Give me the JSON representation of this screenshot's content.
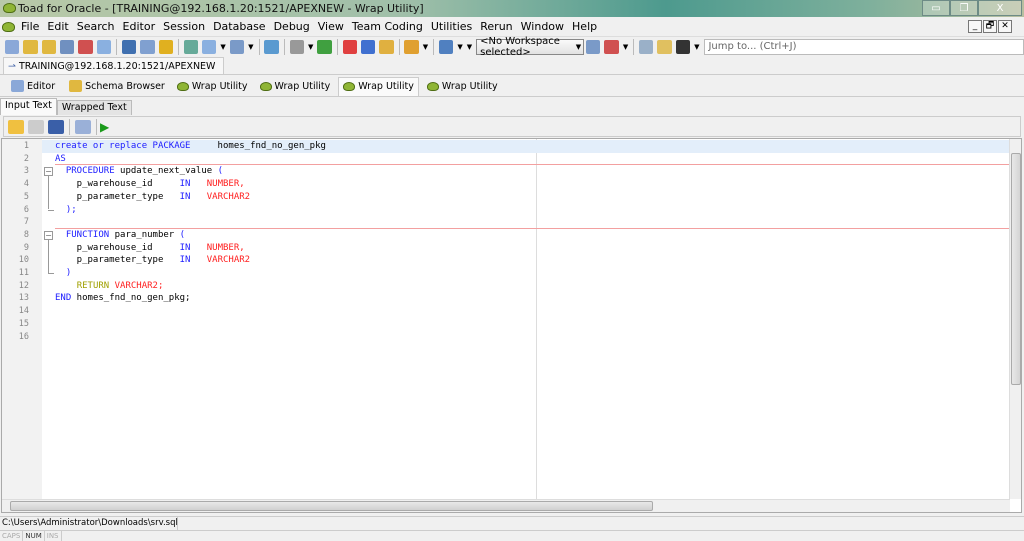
{
  "window": {
    "title": "Toad for Oracle - [TRAINING@192.168.1.20:1521/APEXNEW - Wrap Utility]",
    "minimize": "▭",
    "restore": "❐",
    "close": "X"
  },
  "menu": [
    "File",
    "Edit",
    "Search",
    "Editor",
    "Session",
    "Database",
    "Debug",
    "View",
    "Team Coding",
    "Utilities",
    "Rerun",
    "Window",
    "Help"
  ],
  "mdi_buttons": {
    "minimize": "_",
    "restore": "🗗",
    "close": "✕"
  },
  "toolbar": {
    "workspace": "<No Workspace selected>",
    "jump_placeholder": "Jump to... (Ctrl+J)"
  },
  "connection_tab": "TRAINING@192.168.1.20:1521/APEXNEW",
  "window_tabs": [
    {
      "label": "Editor",
      "icon": "editor-icon"
    },
    {
      "label": "Schema Browser",
      "icon": "schema-browser-icon"
    },
    {
      "label": "Wrap Utility",
      "icon": "frog-icon"
    },
    {
      "label": "Wrap Utility",
      "icon": "frog-icon"
    },
    {
      "label": "Wrap Utility",
      "icon": "frog-icon",
      "active": true
    },
    {
      "label": "Wrap Utility",
      "icon": "frog-icon"
    }
  ],
  "sub_tabs": [
    {
      "label": "Input Text",
      "active": true
    },
    {
      "label": "Wrapped Text"
    }
  ],
  "editor": {
    "lines": [
      [
        [
          "create or replace PACKAGE",
          "kw"
        ],
        [
          "     homes_fnd_no_gen_pkg",
          "id"
        ]
      ],
      [
        [
          "AS",
          "kw"
        ]
      ],
      [
        [
          "  ",
          "id"
        ],
        [
          "PROCEDURE",
          "kw"
        ],
        [
          " update_next_value ",
          "id"
        ],
        [
          "(",
          "kw"
        ]
      ],
      [
        [
          "    p_warehouse_id     ",
          "id"
        ],
        [
          "IN",
          "kw"
        ],
        [
          "   ",
          "id"
        ],
        [
          "NUMBER,",
          "ty"
        ]
      ],
      [
        [
          "    p_parameter_type   ",
          "id"
        ],
        [
          "IN",
          "kw"
        ],
        [
          "   ",
          "id"
        ],
        [
          "VARCHAR2",
          "ty"
        ]
      ],
      [
        [
          "  ",
          "id"
        ],
        [
          ");",
          "kw"
        ]
      ],
      [],
      [
        [
          "  ",
          "id"
        ],
        [
          "FUNCTION",
          "kw"
        ],
        [
          " para_number ",
          "id"
        ],
        [
          "(",
          "kw"
        ]
      ],
      [
        [
          "    p_warehouse_id     ",
          "id"
        ],
        [
          "IN",
          "kw"
        ],
        [
          "   ",
          "id"
        ],
        [
          "NUMBER,",
          "ty"
        ]
      ],
      [
        [
          "    p_parameter_type   ",
          "id"
        ],
        [
          "IN",
          "kw"
        ],
        [
          "   ",
          "id"
        ],
        [
          "VARCHAR2",
          "ty"
        ]
      ],
      [
        [
          "  ",
          "id"
        ],
        [
          ")",
          "kw"
        ]
      ],
      [
        [
          "    ",
          "id"
        ],
        [
          "RETURN",
          "ret"
        ],
        [
          " ",
          "id"
        ],
        [
          "VARCHAR2;",
          "ty"
        ]
      ],
      [
        [
          "END",
          "kw"
        ],
        [
          " homes_fnd_no_gen_pkg;",
          "id"
        ]
      ],
      [],
      [],
      []
    ]
  },
  "status": {
    "path": "C:\\Users\\Administrator\\Downloads\\srv.sql",
    "caps": "CAPS",
    "num": "NUM",
    "ins": "INS"
  }
}
